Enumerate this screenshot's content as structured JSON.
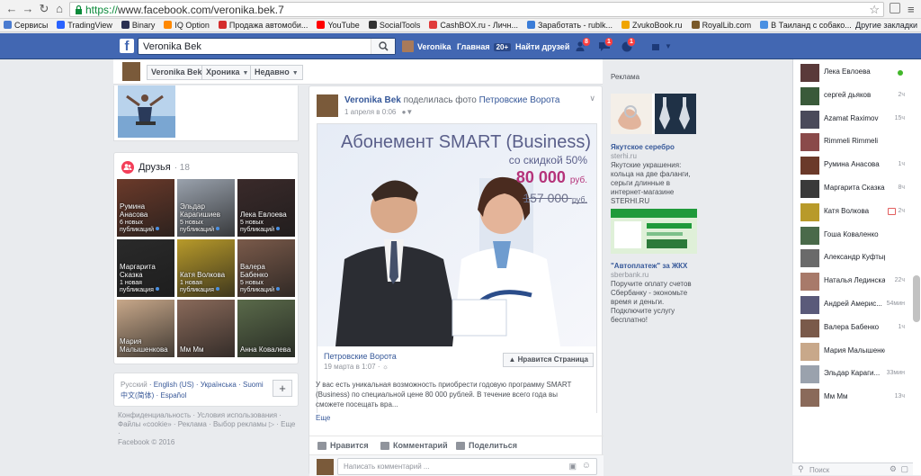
{
  "browser": {
    "url_scheme": "https://",
    "url_rest": "www.facebook.com/veronika.bek.7",
    "bookmarks": [
      {
        "label": "Сервисы",
        "color": "#4a7bd0"
      },
      {
        "label": "TradingView",
        "color": "#2962ff"
      },
      {
        "label": "Binary",
        "color": "#2a3052"
      },
      {
        "label": "IQ Option",
        "color": "#ff8800"
      },
      {
        "label": "Продажа автомоби...",
        "color": "#d42c2c"
      },
      {
        "label": "YouTube",
        "color": "#ff0000"
      },
      {
        "label": "SocialTools",
        "color": "#333333"
      },
      {
        "label": "CashBOX.ru - Личн...",
        "color": "#e03a3a"
      },
      {
        "label": "Заработать - rublk...",
        "color": "#3b7dd8"
      },
      {
        "label": "ZvukoBook.ru",
        "color": "#f0a500"
      },
      {
        "label": "RoyalLib.com",
        "color": "#7a5a2a"
      },
      {
        "label": "В Таиланд с собако...",
        "color": "#4a90e2"
      }
    ],
    "bookmarks_other": "Другие закладки"
  },
  "fb": {
    "search_value": "Veronika Bek",
    "user_name": "Veronika",
    "home_label": "Главная",
    "home_count": "20+",
    "find_friends": "Найти друзей",
    "badges": {
      "friends": "8",
      "messages": "1",
      "notifications": "1"
    }
  },
  "timeline": {
    "name_btn": "Veronika Bek",
    "chronicle_btn": "Хроника",
    "recent_btn": "Недавно"
  },
  "friends": {
    "title": "Друзья",
    "count": "· 18",
    "items": [
      {
        "name": "Румина Анасова",
        "sub": "6 новых публикаций",
        "color": "#6b3a2a"
      },
      {
        "name": "Эльдар Карагишиев",
        "sub": "5 новых публикаций",
        "color": "#9aa2ad"
      },
      {
        "name": "Лека Евлоева",
        "sub": "5 новых публикаций",
        "color": "#3a2a2a"
      },
      {
        "name": "Маргарита Сказка",
        "sub": "1 новая публикация",
        "color": "#2a2a2a"
      },
      {
        "name": "Катя Волкова",
        "sub": "1 новая публикация",
        "color": "#b89a2a"
      },
      {
        "name": "Валера Бабенко",
        "sub": "5 новых публикаций",
        "color": "#7a5a4a"
      },
      {
        "name": "Мария Малышенкова",
        "sub": "",
        "color": "#c8a88a"
      },
      {
        "name": "Мм Мм",
        "sub": "",
        "color": "#8a6a5a"
      },
      {
        "name": "Анна Ковалева",
        "sub": "",
        "color": "#5a6a4a"
      }
    ]
  },
  "languages": {
    "current": "Русский",
    "line1_rest": [
      "English (US)",
      "Українська",
      "Suomi"
    ],
    "line2": [
      "中文(简体)",
      "Español"
    ],
    "add": "+"
  },
  "footer": {
    "line1": "Конфиденциальность · Условия использования ·",
    "line2": "Файлы «cookie» · Реклама · Выбор рекламы ▷ · Еще ·",
    "line3": "Facebook © 2016"
  },
  "post": {
    "author": "Veronika Bek",
    "action": " поделилась фото ",
    "page": "Петровские Ворота",
    "date": "1 апреля в 0:06",
    "ad": {
      "headline": "Абонемент SMART (Business)",
      "discount": "со скидкой 50%",
      "new_price": "80 000",
      "new_price_unit": "руб.",
      "old_price": "157 000",
      "old_price_unit": "руб."
    },
    "share_page": "Петровские Ворота",
    "share_date": "19 марта в 1:07 ·",
    "like_page": "Нравится Страница",
    "share_text": "У вас есть уникальная возможность приобрести годовую программу SMART (Business) по специальной цене 80 000 рублей. В течение всего года вы сможете посещать вра...",
    "more": "Еще",
    "actions": {
      "like": "Нравится",
      "comment": "Комментарий",
      "share": "Поделиться"
    },
    "comment_placeholder": "Написать комментарий ..."
  },
  "ads": {
    "title": "Реклама",
    "ad1": {
      "title": "Якутское серебро",
      "site": "sterhi.ru",
      "text": "Якутские украшения: кольца на две фаланги, серьги длинные в интернет-магазине STERHI.RU"
    },
    "ad2": {
      "title": "\"Автоплатеж\" за ЖКХ",
      "site": "sberbank.ru",
      "text": "Поручите оплату счетов Сбербанку - экономьте время и деньги. Подключите услугу бесплатно!"
    }
  },
  "chat": {
    "contacts": [
      {
        "name": "Лека Евлоева",
        "time": "",
        "online": true,
        "color": "#5a3a3a"
      },
      {
        "name": "сергей дьяков",
        "time": "2ч",
        "color": "#3a5a3a"
      },
      {
        "name": "Azamat Raximov",
        "time": "15ч",
        "color": "#4a4a5a"
      },
      {
        "name": "Rimmeli Rimmeli",
        "time": "",
        "color": "#8a4a4a"
      },
      {
        "name": "Румина Анасова",
        "time": "1ч",
        "color": "#6b3a2a"
      },
      {
        "name": "Маргарита Сказка",
        "time": "8ч",
        "color": "#3a3a3a"
      },
      {
        "name": "Катя Волкова",
        "time": "2ч",
        "gift": true,
        "color": "#b89a2a"
      },
      {
        "name": "Гоша Коваленко",
        "time": "",
        "color": "#4a6a4a"
      },
      {
        "name": "Александр Куфтырев",
        "time": "",
        "color": "#6a6a6a"
      },
      {
        "name": "Наталья Лединская",
        "time": "22ч",
        "color": "#a87a6a"
      },
      {
        "name": "Андрей Америс...",
        "time": "54мин",
        "color": "#5a5a7a"
      },
      {
        "name": "Валера Бабенко",
        "time": "1ч",
        "color": "#7a5a4a"
      },
      {
        "name": "Мария Малышенкова",
        "time": "",
        "color": "#c8a88a"
      },
      {
        "name": "Эльдар Караги...",
        "time": "33мин",
        "color": "#9aa2ad"
      },
      {
        "name": "Мм Мм",
        "time": "13ч",
        "color": "#8a6a5a"
      }
    ],
    "search_placeholder": "Поиск"
  }
}
